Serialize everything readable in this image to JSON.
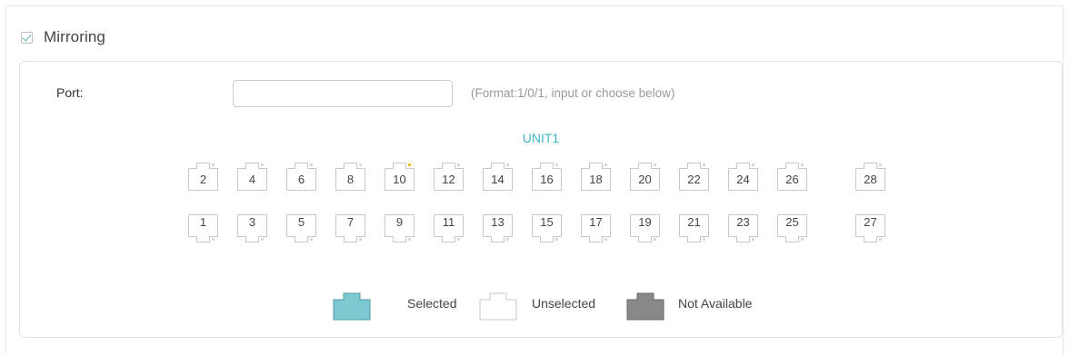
{
  "mirroring": {
    "title": "Mirroring",
    "checked": true
  },
  "port": {
    "label": "Port:",
    "value": "",
    "placeholder": "",
    "hint": "(Format:1/0/1, input or choose below)"
  },
  "unit": {
    "label": "UNIT1"
  },
  "ports_top": [
    "2",
    "4",
    "6",
    "8",
    "10",
    "12",
    "14",
    "16",
    "18",
    "20",
    "22",
    "24",
    "26",
    "28"
  ],
  "ports_bottom": [
    "1",
    "3",
    "5",
    "7",
    "9",
    "11",
    "13",
    "15",
    "17",
    "19",
    "21",
    "23",
    "25",
    "27"
  ],
  "port_status": {
    "10": "link-up-indicator"
  },
  "legend": {
    "selected": "Selected",
    "unselected": "Unselected",
    "not_available": "Not Available"
  },
  "colors": {
    "accent": "#3db6c8",
    "selected_fill": "#7cc9d2",
    "not_available_fill": "#888888",
    "link_indicator": "#f0c020"
  }
}
